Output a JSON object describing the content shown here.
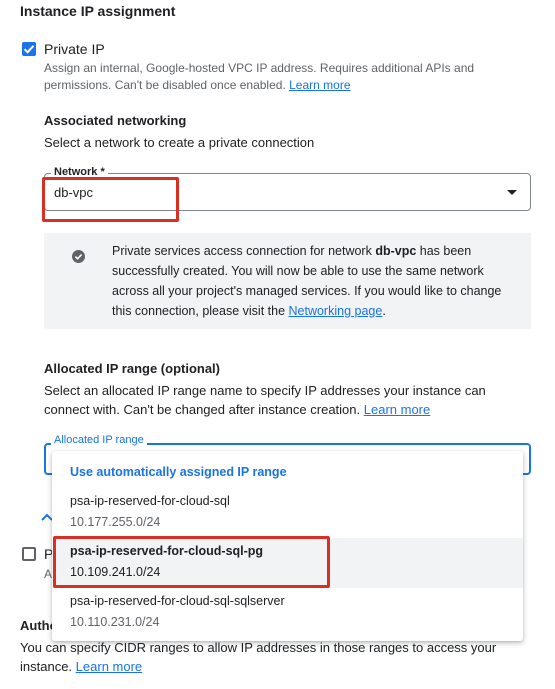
{
  "section": {
    "title": "Instance IP assignment"
  },
  "private_ip": {
    "label": "Private IP",
    "checked": true,
    "description_1": "Assign an internal, Google-hosted VPC IP address. Requires additional APIs and",
    "description_2": "permissions. Can't be disabled once enabled.",
    "learn_more": "Learn more"
  },
  "networking": {
    "title": "Associated networking",
    "description": "Select a network to create a private connection",
    "network_label": "Network *",
    "network_value": "db-vpc"
  },
  "info": {
    "line1_pre": "Private services access connection for network ",
    "line1_bold": "db-vpc",
    "line1_post": " has been",
    "line2": "successfully created. You will now be able to use the same network",
    "line3": "across all your project's managed services. If you would like to change",
    "line4_pre": "this connection, please visit the ",
    "line4_link": "Networking page",
    "line4_post": "."
  },
  "ip_range": {
    "title": "Allocated IP range (optional)",
    "desc_1": "Select an allocated IP range name to specify IP addresses your instance can",
    "desc_2": "connect with. Can't be changed after instance creation.",
    "learn_more": "Learn more",
    "field_label": "Allocated IP range",
    "options_header": "Use automatically assigned IP range",
    "options": [
      {
        "name": "psa-ip-reserved-for-cloud-sql",
        "cidr": "10.177.255.0/24"
      },
      {
        "name": "psa-ip-reserved-for-cloud-sql-pg",
        "cidr": "10.109.241.0/24"
      },
      {
        "name": "psa-ip-reserved-for-cloud-sql-sqlserver",
        "cidr": "10.110.231.0/24"
      }
    ],
    "selected_option": "psa-ip-reserved-for-cloud-sql-pg"
  },
  "public_ip": {
    "label_partial": "P",
    "desc_partial": "A",
    "checked": false
  },
  "authorized": {
    "title_partial": "Autho",
    "desc_1": "You can specify CIDR ranges to allow IP addresses in those ranges to access your",
    "desc_2": "instance.",
    "learn_more": "Learn more"
  },
  "colors": {
    "accent": "#1a73e8",
    "highlight_border": "#d93025",
    "info_bg": "#f1f3f4",
    "selected_row_bg": "#f1f3f4"
  },
  "icons": {
    "checkbox": "check-icon",
    "info": "check-circle-icon",
    "dropdown": "arrow-drop-down-icon",
    "collapse": "chevron-up-icon"
  }
}
